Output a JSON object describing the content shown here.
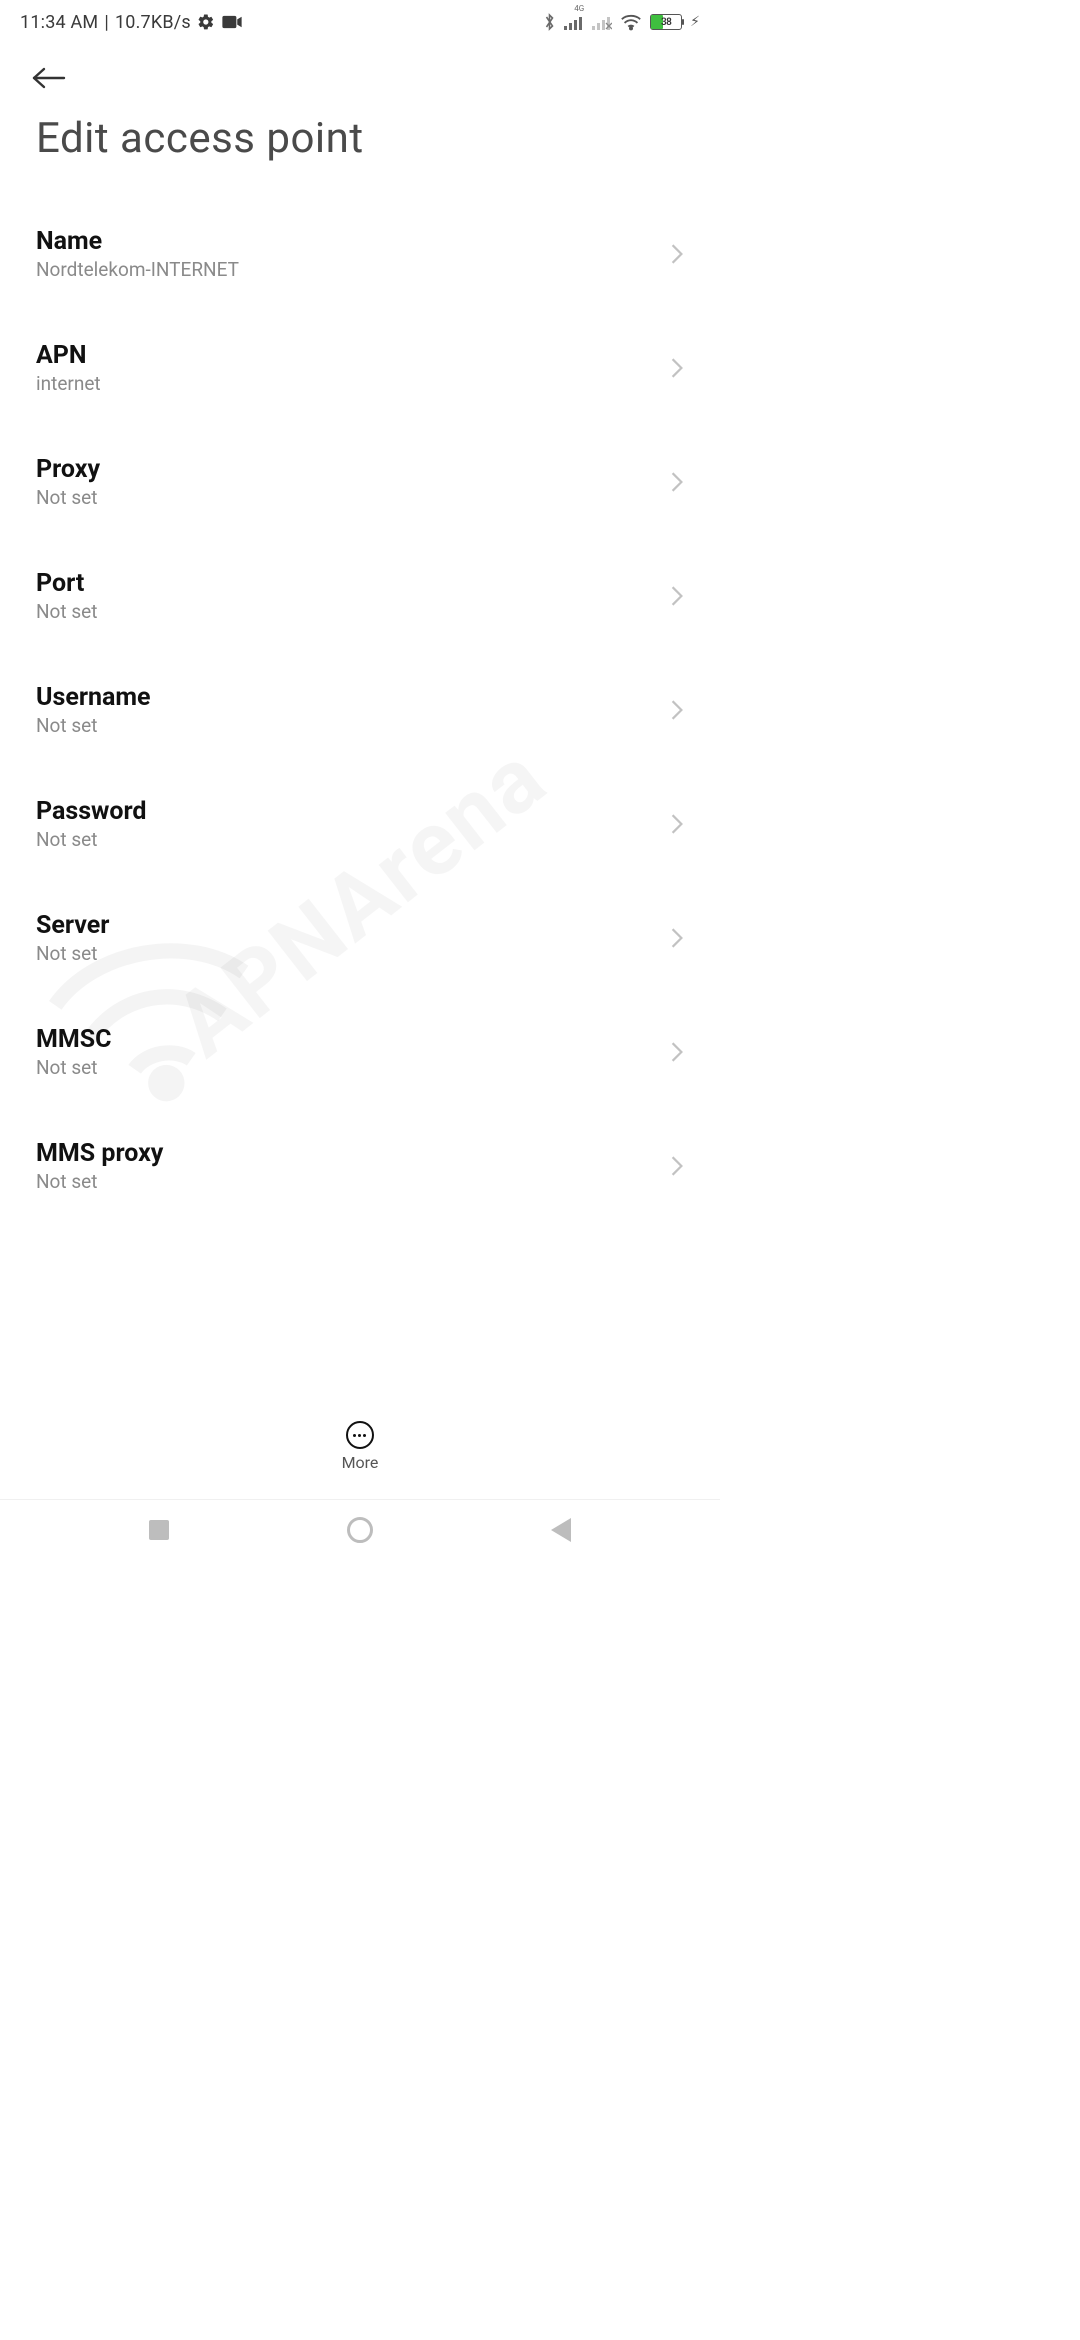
{
  "status": {
    "time": "11:34 AM",
    "net_speed": "10.7KB/s",
    "battery_pct": 38,
    "signal_label": "4G"
  },
  "page": {
    "title": "Edit access point"
  },
  "fields": [
    {
      "label": "Name",
      "value": "Nordtelekom-INTERNET"
    },
    {
      "label": "APN",
      "value": "internet"
    },
    {
      "label": "Proxy",
      "value": "Not set"
    },
    {
      "label": "Port",
      "value": "Not set"
    },
    {
      "label": "Username",
      "value": "Not set"
    },
    {
      "label": "Password",
      "value": "Not set"
    },
    {
      "label": "Server",
      "value": "Not set"
    },
    {
      "label": "MMSC",
      "value": "Not set"
    },
    {
      "label": "MMS proxy",
      "value": "Not set"
    }
  ],
  "action": {
    "more_label": "More"
  },
  "watermark": "APNArena"
}
